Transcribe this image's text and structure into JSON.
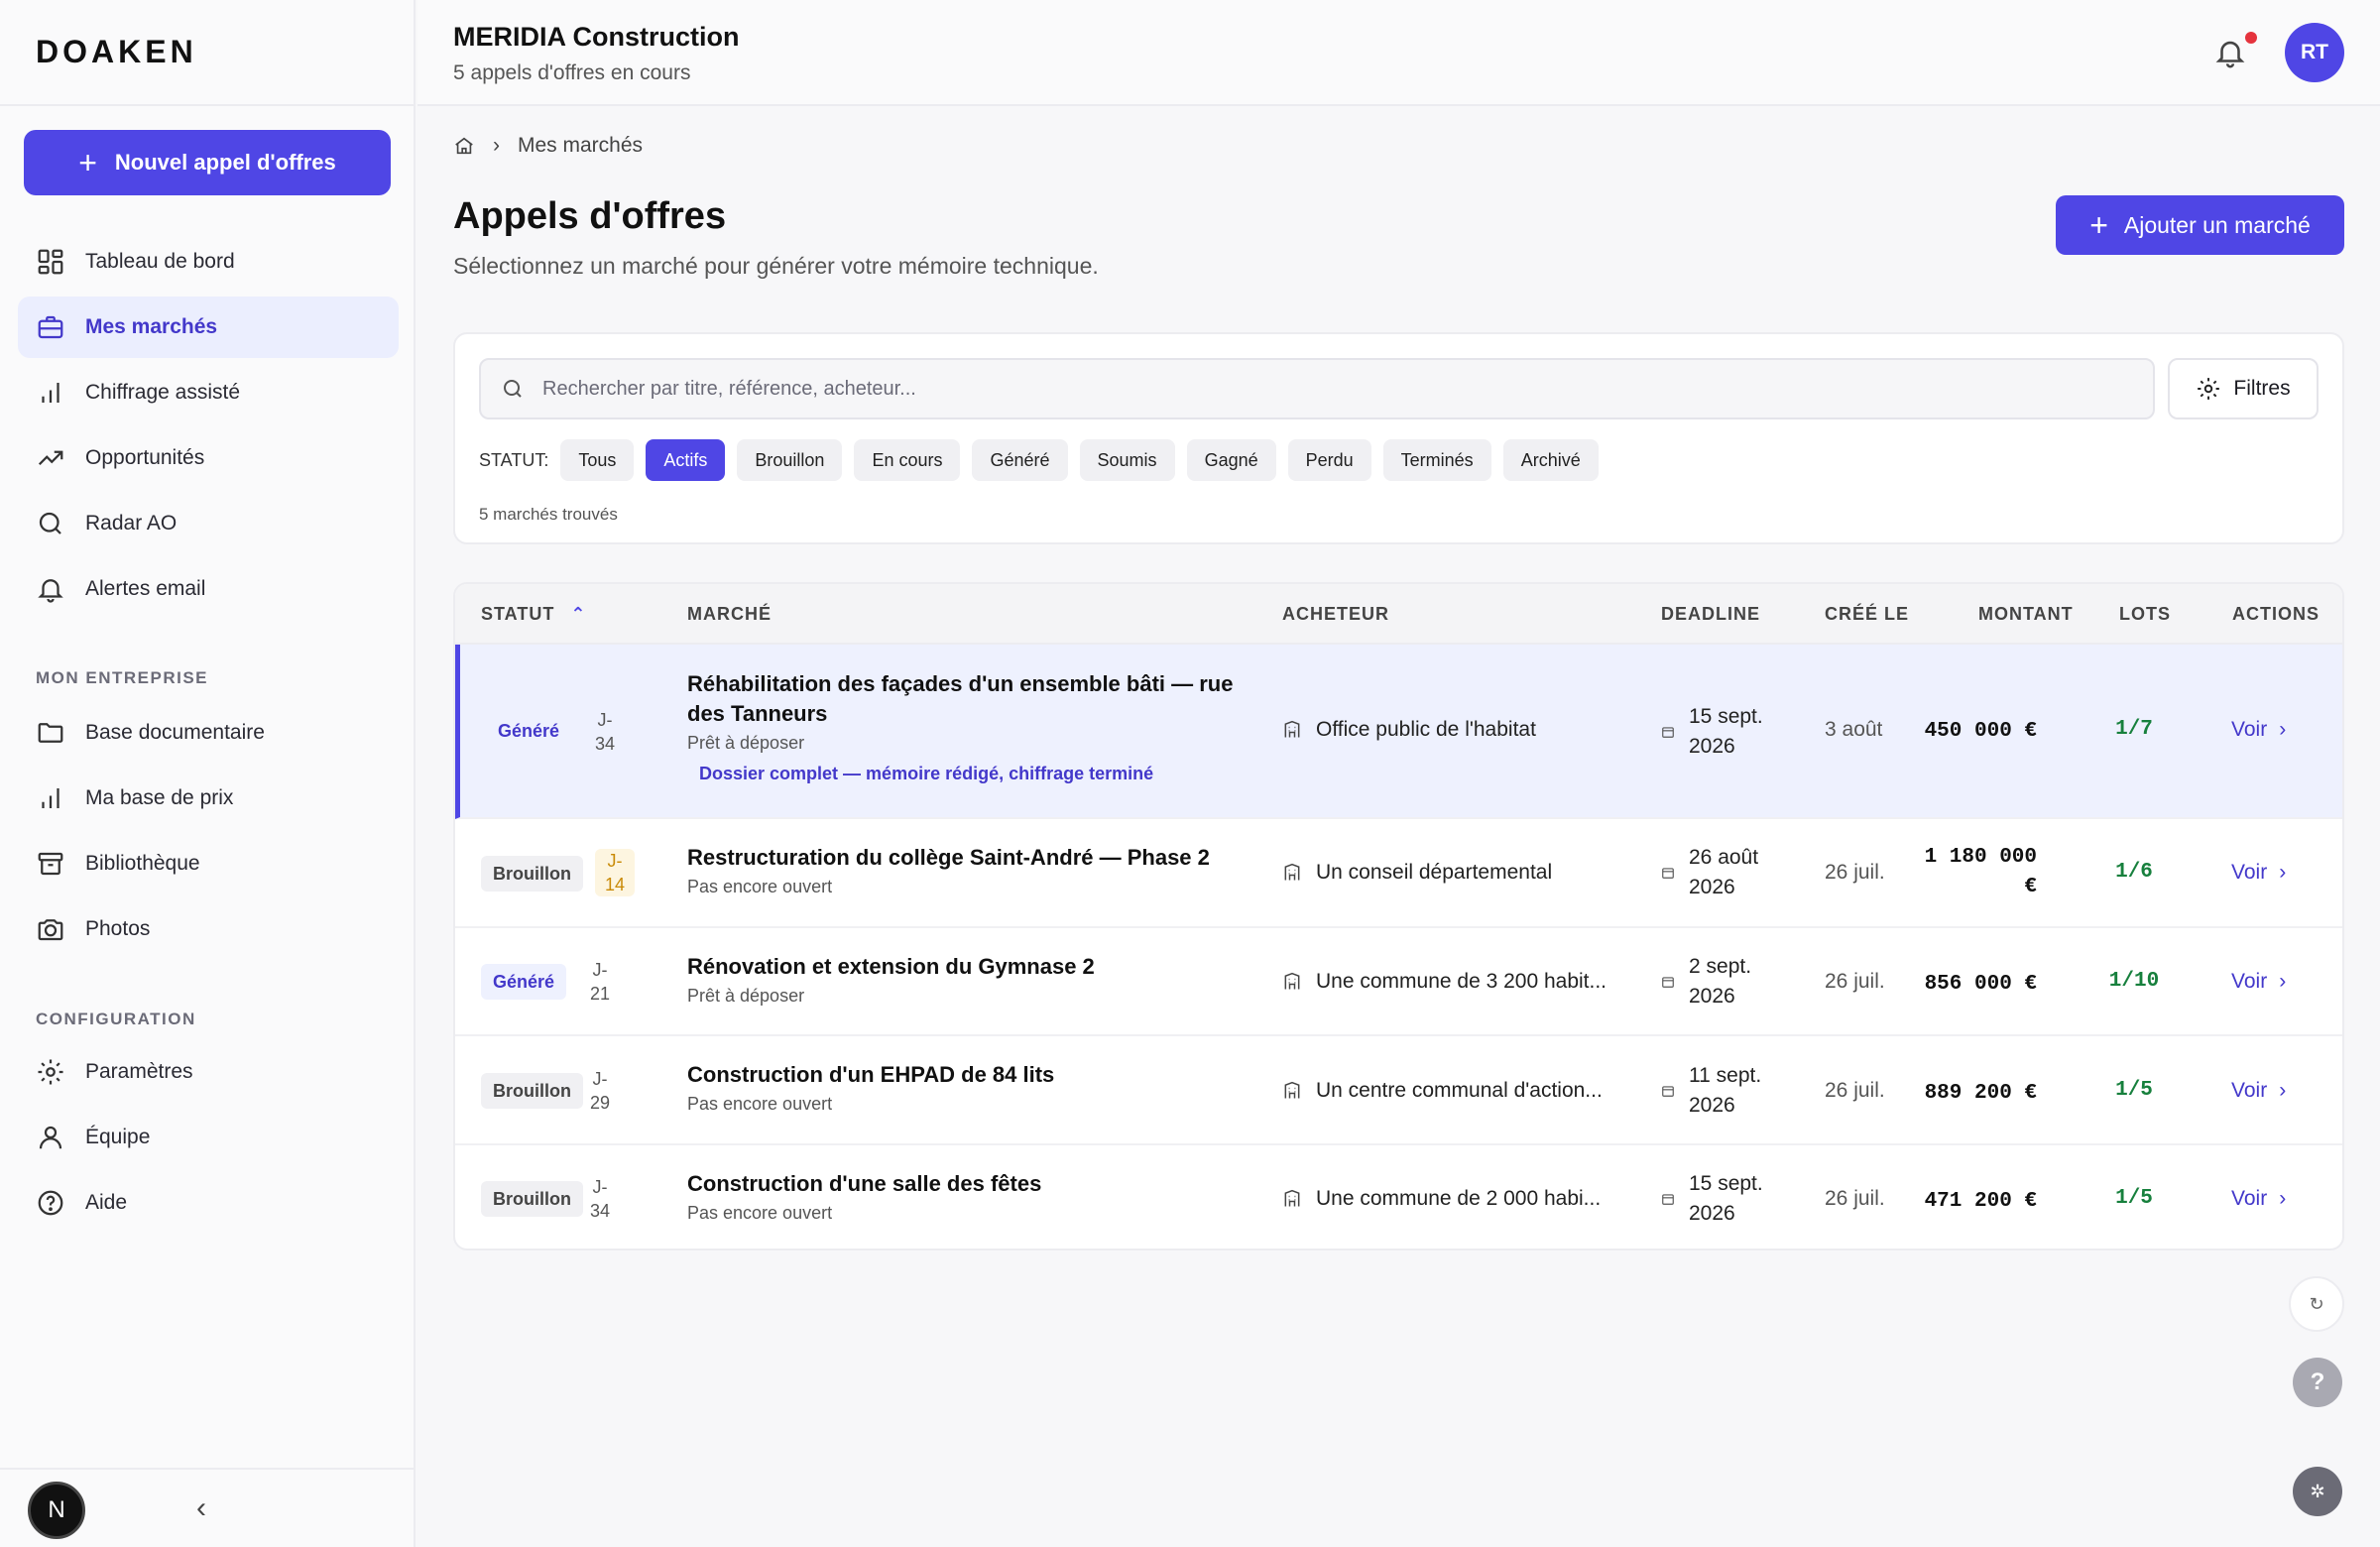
{
  "brand": "DOAKEN",
  "sidebar": {
    "new_button": "Nouvel appel d'offres",
    "nav": [
      {
        "label": "Tableau de bord",
        "icon": "dashboard-icon"
      },
      {
        "label": "Mes marchés",
        "icon": "briefcase-icon"
      },
      {
        "label": "Chiffrage assisté",
        "icon": "bar-chart-icon"
      },
      {
        "label": "Opportunités",
        "icon": "trending-up-icon"
      },
      {
        "label": "Radar AO",
        "icon": "search-icon"
      },
      {
        "label": "Alertes email",
        "icon": "bell-icon"
      }
    ],
    "section_company": "MON ENTREPRISE",
    "company_nav": [
      {
        "label": "Base documentaire",
        "icon": "folder-icon"
      },
      {
        "label": "Ma base de prix",
        "icon": "bar-chart-icon"
      },
      {
        "label": "Bibliothèque",
        "icon": "archive-icon"
      },
      {
        "label": "Photos",
        "icon": "camera-icon"
      }
    ],
    "section_config": "CONFIGURATION",
    "config_nav": [
      {
        "label": "Paramètres",
        "icon": "gear-icon"
      },
      {
        "label": "Équipe",
        "icon": "user-icon"
      },
      {
        "label": "Aide",
        "icon": "help-icon"
      }
    ],
    "bottom_badge": "N"
  },
  "header": {
    "company": "MERIDIA Construction",
    "subtitle": "5 appels d'offres en cours",
    "avatar": "RT"
  },
  "breadcrumb": {
    "current": "Mes marchés"
  },
  "page": {
    "title": "Appels d'offres",
    "subtitle": "Sélectionnez un marché pour générer votre mémoire technique.",
    "add_button": "Ajouter un marché"
  },
  "filters": {
    "search_placeholder": "Rechercher par titre, référence, acheteur...",
    "filters_button": "Filtres",
    "status_label": "STATUT:",
    "chips": [
      "Tous",
      "Actifs",
      "Brouillon",
      "En cours",
      "Généré",
      "Soumis",
      "Gagné",
      "Perdu",
      "Terminés",
      "Archivé"
    ],
    "active_chip": "Actifs",
    "found": "5 marchés trouvés"
  },
  "table": {
    "columns": [
      "STATUT",
      "MARCHÉ",
      "ACHETEUR",
      "DEADLINE",
      "CRÉÉ LE",
      "MONTANT",
      "LOTS",
      "ACTIONS"
    ],
    "rows": [
      {
        "status": "Généré",
        "j": "J-\n34",
        "title": "Réhabilitation des façades d'un ensemble bâti — rue des Tanneurs",
        "sub": "Prêt à déposer",
        "note": "Dossier complet — mémoire rédigé, chiffrage terminé",
        "buyer": "Office public de l'habitat",
        "deadline": "15 sept.\n2026",
        "created": "3 août",
        "amount": "450 000 €",
        "lots": "1/7",
        "action": "Voir"
      },
      {
        "status": "Brouillon",
        "j": "J-\n14",
        "title": "Restructuration du collège Saint-André — Phase 2",
        "sub": "Pas encore ouvert",
        "note": "",
        "buyer": "Un conseil départemental",
        "deadline": "26 août\n2026",
        "created": "26 juil.",
        "amount": "1 180 000\n€",
        "lots": "1/6",
        "action": "Voir"
      },
      {
        "status": "Généré",
        "j": "J-\n21",
        "title": "Rénovation et extension du Gymnase 2",
        "sub": "Prêt à déposer",
        "note": "",
        "buyer": "Une commune de 3 200 habit...",
        "deadline": "2 sept.\n2026",
        "created": "26 juil.",
        "amount": "856 000 €",
        "lots": "1/10",
        "action": "Voir"
      },
      {
        "status": "Brouillon",
        "j": "J-\n29",
        "title": "Construction d'un EHPAD de 84 lits",
        "sub": "Pas encore ouvert",
        "note": "",
        "buyer": "Un centre communal d'action...",
        "deadline": "11 sept.\n2026",
        "created": "26 juil.",
        "amount": "889 200 €",
        "lots": "1/5",
        "action": "Voir"
      },
      {
        "status": "Brouillon",
        "j": "J-\n34",
        "title": "Construction d'une salle des fêtes",
        "sub": "Pas encore ouvert",
        "note": "",
        "buyer": "Une commune de 2 000 habi...",
        "deadline": "15 sept.\n2026",
        "created": "26 juil.",
        "amount": "471 200 €",
        "lots": "1/5",
        "action": "Voir"
      }
    ]
  },
  "colors": {
    "accent": "#4f46e5",
    "lots_green": "#17803d",
    "warn": "#c98a07"
  }
}
